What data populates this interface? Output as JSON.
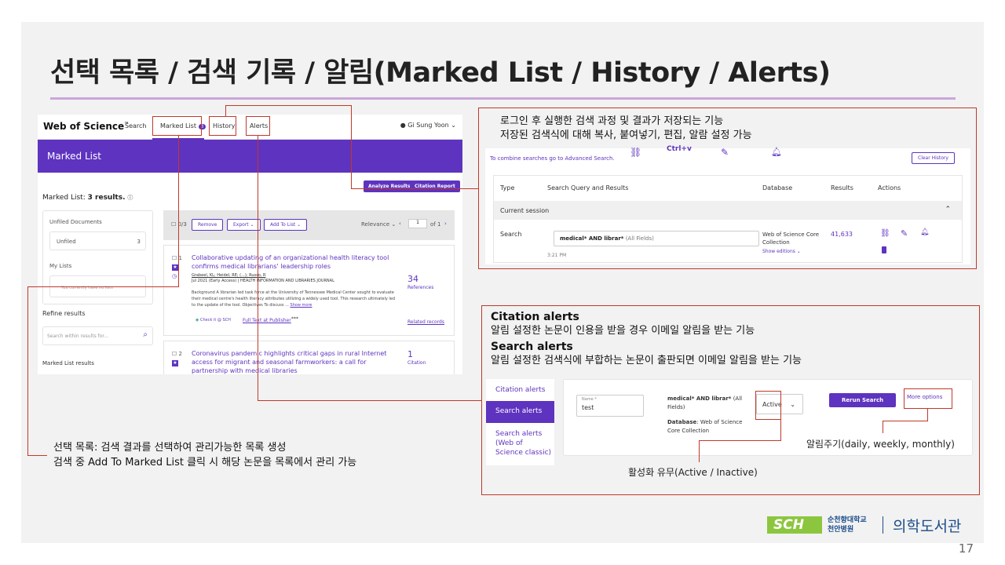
{
  "slide": {
    "title": "선택 목록 / 검색 기록 / 알림(Marked List / History / Alerts)",
    "page_number": "17"
  },
  "wos": {
    "brand": "Web of Science",
    "tm": "™",
    "nav": {
      "search": "Search",
      "marked_list": "Marked List",
      "marked_count": "3",
      "history": "History",
      "alerts": "Alerts"
    },
    "user": "Gi Sung Yoon",
    "page_title": "Marked List",
    "analyze_btn": "Analyze Results",
    "citation_btn": "Citation Report",
    "marked_count_label": "Marked List:",
    "marked_count_value": "3 results.",
    "unfiled_documents": "Unfiled Documents",
    "unfiled": "Unfiled",
    "unfiled_count": "3",
    "my_lists": "My Lists",
    "no_lists": "You currently have no lists",
    "refine": "Refine results",
    "search_placeholder": "Search within results for...",
    "marked_list_results": "Marked List results",
    "toolbar": {
      "count": "0/3",
      "remove": "Remove",
      "export": "Export",
      "add_to_list": "Add To List",
      "relevance": "Relevance",
      "page": "1",
      "of": "of 1"
    },
    "records": [
      {
        "num": "1",
        "title": "Collaborative updating of an organizational health literacy tool confirms medical librarians' leadership roles",
        "authors": "Grabeel, KL; Heidel, RE; (...); Russo, R",
        "meta": "Jul 2021 (Early Access) | HEALTH INFORMATION AND LIBRARIES JOURNAL",
        "abstract": "Background A librarian led task force at the University of Tennessee Medical Center sought to evaluate their medical centre's health literacy attributes utilizing a widely used tool. This research ultimately led to the update of the tool. Objectives To discuss ...",
        "show_more": "Show more",
        "check_it": "Check it @ SCH",
        "full_text": "Full Text at Publisher",
        "more": "***",
        "count": "34",
        "count_label": "References",
        "related": "Related records"
      },
      {
        "num": "2",
        "title": "Coronavirus pandemic highlights critical gaps in rural Internet access for migrant and seasonal farmworkers: a call for partnership with medical libraries",
        "count": "1",
        "count_label": "Citation"
      }
    ]
  },
  "history": {
    "desc1": "로그인 후 실행한 검색 과정 및 결과가 저장되는 기능",
    "desc2": "저장된 검색식에 대해 복사, 붙여넣기, 편집, 알람 설정 가능",
    "ctrlv": "Ctrl+v",
    "combine_link": "To combine searches go to Advanced Search.",
    "clear_history": "Clear History",
    "columns": {
      "type": "Type",
      "query": "Search Query and Results",
      "database": "Database",
      "results": "Results",
      "actions": "Actions"
    },
    "current_session": "Current session",
    "row": {
      "type": "Search",
      "query_bold": "medical* AND librar*",
      "query_field": "(All Fields)",
      "time": "3:21 PM",
      "database": "Web of Science Core Collection",
      "show_editions": "Show editions",
      "results": "41,633"
    }
  },
  "alerts_desc": {
    "citation_head": "Citation alerts",
    "citation_body": "알림 설정한 논문이 인용을 받을 경우 이메일 알림을 받는 기능",
    "search_head": "Search alerts",
    "search_body": "알림 설정한 검색식에 부합하는 논문이 출판되면 이메일 알림을 받는 기능"
  },
  "alerts": {
    "side": {
      "citation": "Citation alerts",
      "search": "Search alerts",
      "classic": "Search alerts (Web of Science classic)"
    },
    "name_label": "Name *",
    "name_value": "test",
    "query_bold": "medical* AND librar*",
    "query_field": "(All Fields)",
    "database_label": "Database",
    "database_value": ": Web of Science Core Collection",
    "status": "Active",
    "rerun": "Rerun Search",
    "more_options": "More options",
    "note_frequency": "알림주기(daily,  weekly, monthly)",
    "note_status": "활성화 유무(Active  / Inactive)"
  },
  "marked_note": {
    "line1": "선택 목록: 검색 결과를 선택하여 관리가능한 목록 생성",
    "line2": "검색 중 Add To Marked List 클릭 시 해당 논문을 목록에서 관리 가능"
  },
  "logo": {
    "mark": "SCH",
    "univ1": "순천향대학교",
    "univ2": "천안병원",
    "library": "의학도서관"
  },
  "colors": {
    "brand_purple": "#5e33bf",
    "callout_red": "#c0392b",
    "title_rule": "#c9a6d9",
    "logo_green": "#8cc63f"
  }
}
